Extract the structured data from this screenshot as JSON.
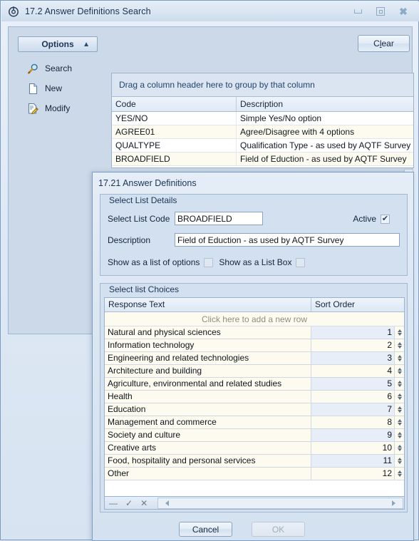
{
  "window": {
    "title": "17.2 Answer Definitions Search",
    "icon": "app-target-icon",
    "buttons": {
      "minimize": "minimize-icon",
      "restore": "restore-icon",
      "close": "close-icon"
    }
  },
  "toolbar": {
    "clear_label_prefix": "C",
    "clear_label_accel": "l",
    "clear_label_suffix": "ear",
    "clear_label": "Clear"
  },
  "options": {
    "header_label": "Options",
    "collapse_icon": "chevron-up-icon",
    "items": [
      {
        "label": "Search",
        "icon": "magnifier-icon"
      },
      {
        "label": "New",
        "icon": "page-icon"
      },
      {
        "label": "Modify",
        "icon": "page-edit-icon"
      }
    ]
  },
  "results_grid": {
    "group_hint": "Drag a column header here to group by that column",
    "columns": [
      "Code",
      "Description"
    ],
    "rows": [
      {
        "code": "YES/NO",
        "description": "Simple Yes/No option"
      },
      {
        "code": "AGREE01",
        "description": "Agree/Disagree with 4 options"
      },
      {
        "code": "QUALTYPE",
        "description": "Qualification Type - as used by AQTF Survey"
      },
      {
        "code": "BROADFIELD",
        "description": "Field of Eduction - as used by AQTF Survey"
      }
    ]
  },
  "dialog": {
    "title": "17.21 Answer Definitions",
    "details_group": {
      "caption": "Select List Details",
      "code_label": "Select List Code",
      "code_value": "BROADFIELD",
      "code_placeholder": "",
      "description_label": "Description",
      "description_value": "Field of Eduction - as used by AQTF Survey",
      "description_placeholder": "",
      "active_label": "Active",
      "active_checked": true,
      "active_mark": "✔",
      "show_list_options_label": "Show as a list of options",
      "show_list_options_checked": false,
      "show_list_box_label": "Show as a List Box",
      "show_list_box_checked": false
    },
    "choices_group": {
      "caption": "Select list Choices",
      "columns": [
        "Response Text",
        "Sort Order"
      ],
      "new_row_hint": "Click here to add a new row",
      "rows": [
        {
          "text": "Natural and physical sciences",
          "sort": "1"
        },
        {
          "text": "Information technology",
          "sort": "2"
        },
        {
          "text": "Engineering and related technologies",
          "sort": "3"
        },
        {
          "text": "Architecture and building",
          "sort": "4"
        },
        {
          "text": "Agriculture, environmental and related studies",
          "sort": "5"
        },
        {
          "text": "Health",
          "sort": "6"
        },
        {
          "text": "Education",
          "sort": "7"
        },
        {
          "text": "Management and commerce",
          "sort": "8"
        },
        {
          "text": "Society and culture",
          "sort": "9"
        },
        {
          "text": "Creative arts",
          "sort": "10"
        },
        {
          "text": "Food, hospitality and personal services",
          "sort": "11"
        },
        {
          "text": "Other",
          "sort": "12"
        }
      ],
      "footer_tools": [
        {
          "name": "delete-row-icon",
          "glyph": "—"
        },
        {
          "name": "confirm-edit-icon",
          "glyph": "✓"
        },
        {
          "name": "cancel-edit-icon",
          "glyph": "✕"
        }
      ]
    },
    "buttons": {
      "cancel_label": "Cancel",
      "ok_label": "OK",
      "ok_disabled": true
    }
  },
  "colors": {
    "window_bg": "#dce6f2",
    "panel_bg": "#ccd9e8",
    "accent_border": "#7a9cc0",
    "grid_row_alt": "#fdfbef",
    "text": "#15233b"
  }
}
